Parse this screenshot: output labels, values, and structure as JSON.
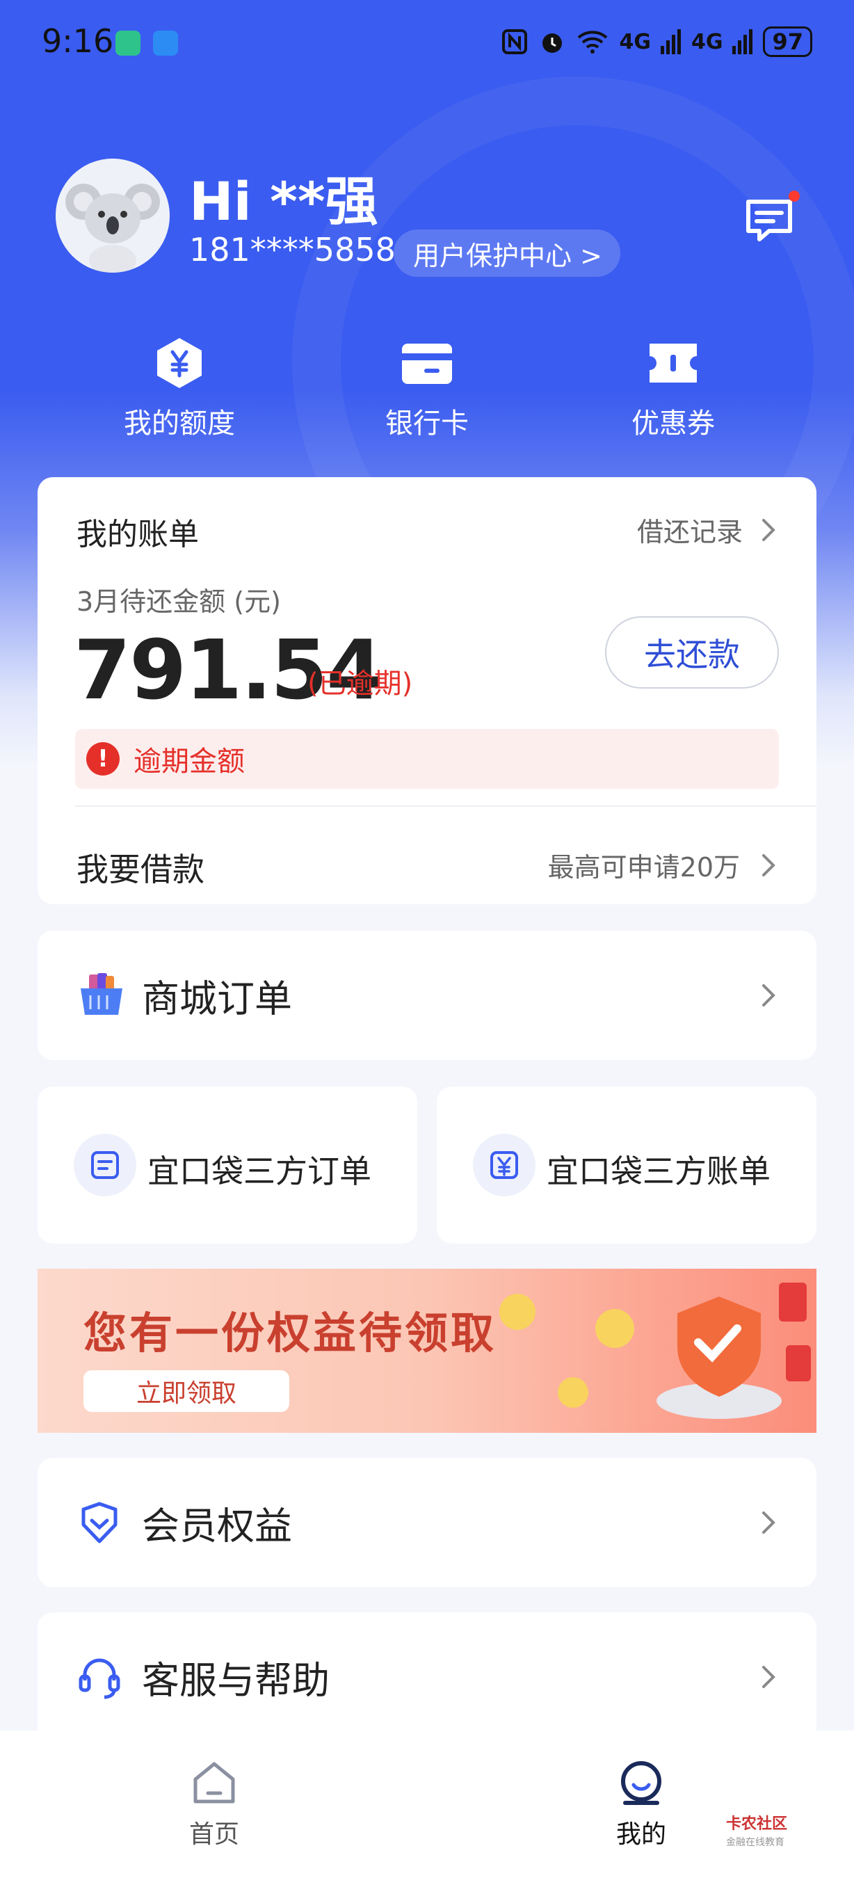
{
  "status_bar": {
    "time": "9:16",
    "signal_1": "4G",
    "signal_2": "4G",
    "battery": "97"
  },
  "profile": {
    "greeting": "Hi **强",
    "phone": "181****5858",
    "protect_center": "用户保护中心 >"
  },
  "quick_actions": [
    {
      "label": "我的额度",
      "icon": "yuan-hexagon-icon"
    },
    {
      "label": "银行卡",
      "icon": "bank-card-icon"
    },
    {
      "label": "优惠券",
      "icon": "coupon-icon"
    }
  ],
  "bill": {
    "title": "我的账单",
    "history_link": "借还记录",
    "subtitle": "3月待还金额 (元)",
    "amount": "791.54",
    "status": "(已逾期)",
    "repay_button": "去还款",
    "overdue_notice": "逾期金额",
    "borrow_label": "我要借款",
    "borrow_hint": "最高可申请20万"
  },
  "mall_order": {
    "label": "商城订单"
  },
  "third_party": {
    "orders": "宜口袋三方订单",
    "bills": "宜口袋三方账单"
  },
  "banner": {
    "title": "您有一份权益待领取",
    "button": "立即领取"
  },
  "menu": {
    "membership": "会员权益",
    "support": "客服与帮助"
  },
  "tabbar": {
    "home": "首页",
    "mine": "我的",
    "active": "mine"
  },
  "watermark": {
    "line1": "卡农社区",
    "line2": "金融在线教育"
  },
  "colors": {
    "primary": "#3a5cf0",
    "accent_blue": "#2f4ed6",
    "alert_red": "#e5302a",
    "background": "#f4f6fc"
  }
}
